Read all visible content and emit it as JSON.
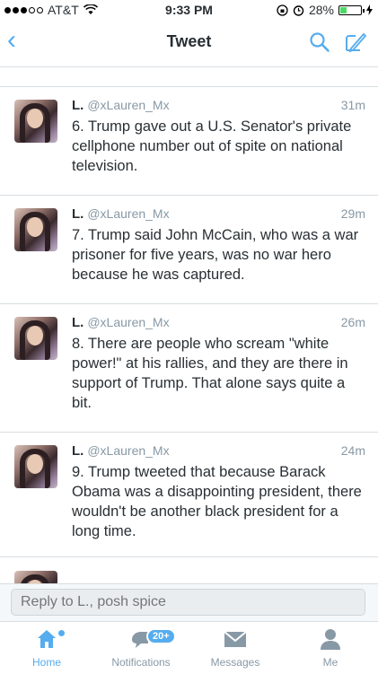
{
  "status": {
    "carrier": "AT&T",
    "time": "9:33 PM",
    "battery": "28%"
  },
  "nav": {
    "title": "Tweet"
  },
  "tweets": [
    {
      "name": "L.",
      "handle": "@xLauren_Mx",
      "time": "31m",
      "text": "6. Trump gave out a U.S. Senator's private cellphone number out of spite on national television."
    },
    {
      "name": "L.",
      "handle": "@xLauren_Mx",
      "time": "29m",
      "text": "7. Trump said John McCain, who was a war prisoner for five years, was no war hero because he was captured."
    },
    {
      "name": "L.",
      "handle": "@xLauren_Mx",
      "time": "26m",
      "text": "8. There are people who scream \"white power!\" at his rallies, and they are there in support of Trump. That alone says quite a bit."
    },
    {
      "name": "L.",
      "handle": "@xLauren_Mx",
      "time": "24m",
      "text": "9. Trump tweeted that because Barack Obama was a disappointing president, there wouldn't be another black president for a long time."
    }
  ],
  "reply": {
    "placeholder": "Reply to L., posh spice"
  },
  "tabs": [
    {
      "label": "Home",
      "icon": "home-icon",
      "active": true
    },
    {
      "label": "Notifications",
      "icon": "notifications-icon",
      "badge": "20+"
    },
    {
      "label": "Messages",
      "icon": "messages-icon"
    },
    {
      "label": "Me",
      "icon": "me-icon"
    }
  ],
  "colors": {
    "accent": "#55acee",
    "text": "#292f33",
    "muted": "#8899a6"
  }
}
